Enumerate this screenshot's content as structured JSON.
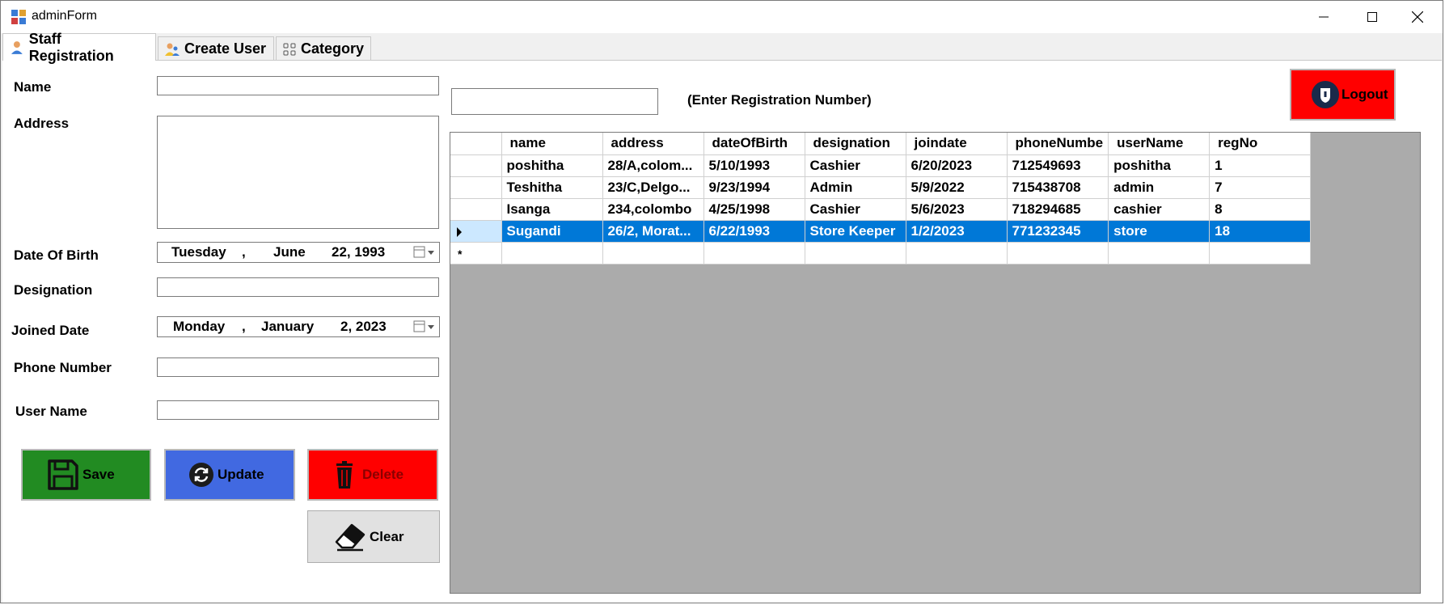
{
  "window": {
    "title": "adminForm"
  },
  "tabs": [
    {
      "label": "Staff Registration",
      "icon": "person-icon"
    },
    {
      "label": "Create User",
      "icon": "users-icon"
    },
    {
      "label": "Category",
      "icon": "category-icon"
    }
  ],
  "form": {
    "name_label": "Name",
    "address_label": "Address",
    "dob_label": "Date Of Birth",
    "dob": {
      "day": "Tuesday",
      "month": "June",
      "date": "22, 1993"
    },
    "designation_label": "Designation",
    "joined_label": "Joined Date",
    "joined": {
      "day": "Monday",
      "month": "January",
      "date": "2, 2023"
    },
    "phone_label": "Phone Number",
    "username_label": "User Name"
  },
  "buttons": {
    "save": "Save",
    "update": "Update",
    "delete": "Delete",
    "clear": "Clear",
    "logout": "Logout"
  },
  "search": {
    "hint": "(Enter Registration Number)"
  },
  "grid": {
    "columns": [
      "name",
      "address",
      "dateOfBirth",
      "designation",
      "joindate",
      "phoneNumbe",
      "userName",
      "regNo"
    ],
    "rows": [
      [
        "poshitha",
        "28/A,colom...",
        "5/10/1993",
        "Cashier",
        "6/20/2023",
        "712549693",
        "poshitha",
        "1"
      ],
      [
        "Teshitha",
        "23/C,Delgo...",
        "9/23/1994",
        "Admin",
        "5/9/2022",
        "715438708",
        "admin",
        "7"
      ],
      [
        "Isanga",
        "234,colombo",
        "4/25/1998",
        "Cashier",
        "5/6/2023",
        "718294685",
        "cashier",
        "8"
      ],
      [
        "Sugandi",
        "26/2, Morat...",
        "6/22/1993",
        "Store Keeper",
        "1/2/2023",
        "771232345",
        "store",
        "18"
      ]
    ],
    "selected_row": 3
  },
  "colors": {
    "save": "#228b22",
    "update": "#4169e1",
    "delete": "#ff0000",
    "logout": "#ff0000",
    "selection": "#0078d7"
  }
}
